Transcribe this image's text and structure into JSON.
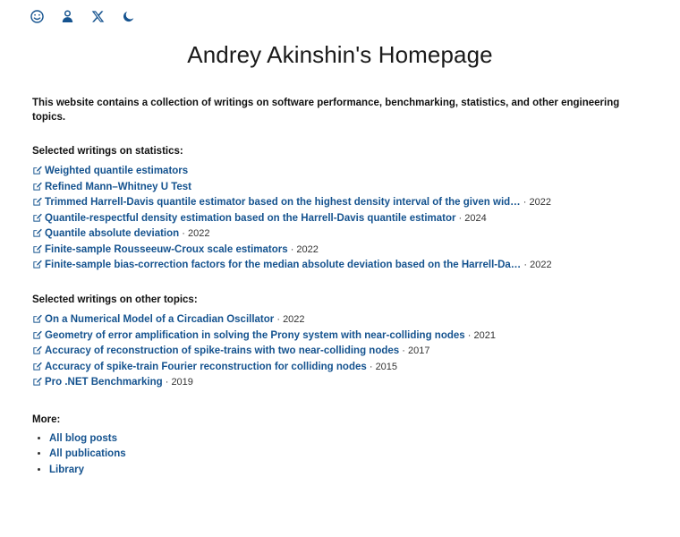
{
  "colors": {
    "link": "#15538f",
    "text": "#111111",
    "year": "#333333",
    "background": "#ffffff"
  },
  "topbar": {
    "icons": [
      {
        "name": "smiley-icon",
        "label": "About me"
      },
      {
        "name": "person-icon",
        "label": "Profile"
      },
      {
        "name": "x-twitter-icon",
        "label": "X"
      },
      {
        "name": "moon-icon",
        "label": "Dark mode"
      }
    ]
  },
  "header": {
    "title": "Andrey Akinshin's Homepage"
  },
  "main": {
    "intro": "This website contains a collection of writings on software performance, benchmarking, statistics, and other engineering topics.",
    "sections": [
      {
        "heading": "Selected writings on statistics:",
        "items": [
          {
            "title": "Weighted quantile estimators",
            "year": ""
          },
          {
            "title": "Refined Mann–Whitney U Test",
            "year": ""
          },
          {
            "title": "Trimmed Harrell-Davis quantile estimator based on the highest density interval of the given wid…",
            "year": "2022"
          },
          {
            "title": "Quantile-respectful density estimation based on the Harrell-Davis quantile estimator",
            "year": "2024"
          },
          {
            "title": "Quantile absolute deviation",
            "year": "2022"
          },
          {
            "title": "Finite-sample Rousseeuw-Croux scale estimators",
            "year": "2022"
          },
          {
            "title": "Finite-sample bias-correction factors for the median absolute deviation based on the Harrell-Da…",
            "year": "2022"
          }
        ]
      },
      {
        "heading": "Selected writings on other topics:",
        "items": [
          {
            "title": "On a Numerical Model of a Circadian Oscillator",
            "year": "2022"
          },
          {
            "title": "Geometry of error amplification in solving the Prony system with near-colliding nodes",
            "year": "2021"
          },
          {
            "title": "Accuracy of reconstruction of spike-trains with two near-colliding nodes",
            "year": "2017"
          },
          {
            "title": "Accuracy of spike-train Fourier reconstruction for colliding nodes",
            "year": "2015"
          },
          {
            "title": "Pro .NET Benchmarking",
            "year": "2019"
          }
        ]
      }
    ],
    "more": {
      "heading": "More:",
      "links": [
        {
          "label": "All blog posts"
        },
        {
          "label": "All publications"
        },
        {
          "label": "Library"
        }
      ]
    },
    "year_separator": "·"
  }
}
